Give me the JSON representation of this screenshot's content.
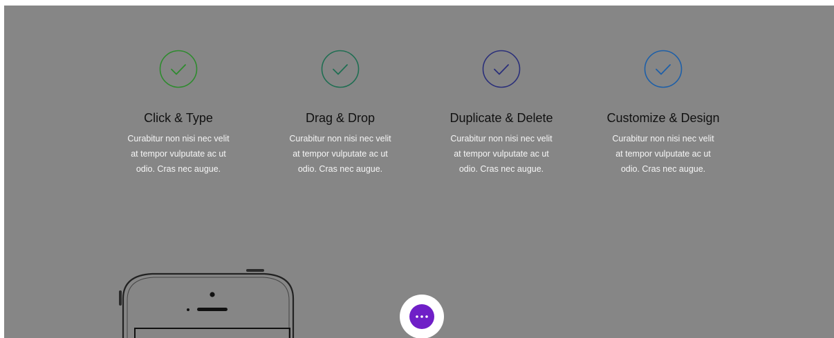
{
  "colors": {
    "overlay": "#868686",
    "fab_accent": "#6f1fc7",
    "check_1": "#2e8b2e",
    "check_2": "#1f6e52",
    "check_3": "#2a2f7a",
    "check_4": "#1d5fa8"
  },
  "features": [
    {
      "title": "Click & Type",
      "lines": [
        "Curabitur non nisi nec velit",
        "at tempor vulputate ac ut",
        "odio. Cras nec augue."
      ],
      "icon": "check-circle-icon"
    },
    {
      "title": "Drag & Drop",
      "lines": [
        "Curabitur non nisi nec velit",
        "at tempor vulputate ac ut",
        "odio. Cras nec augue."
      ],
      "icon": "check-circle-icon"
    },
    {
      "title": "Duplicate & Delete",
      "lines": [
        "Curabitur non nisi nec velit",
        "at tempor vulputate ac ut",
        "odio. Cras nec augue."
      ],
      "icon": "check-circle-icon"
    },
    {
      "title": "Customize & Design",
      "lines": [
        "Curabitur non nisi nec velit",
        "at tempor vulputate ac ut",
        "odio. Cras nec augue."
      ],
      "icon": "check-circle-icon"
    }
  ],
  "phone": {
    "icon": "phone-mockup-icon"
  },
  "fab": {
    "icon": "more-horizontal-icon"
  }
}
